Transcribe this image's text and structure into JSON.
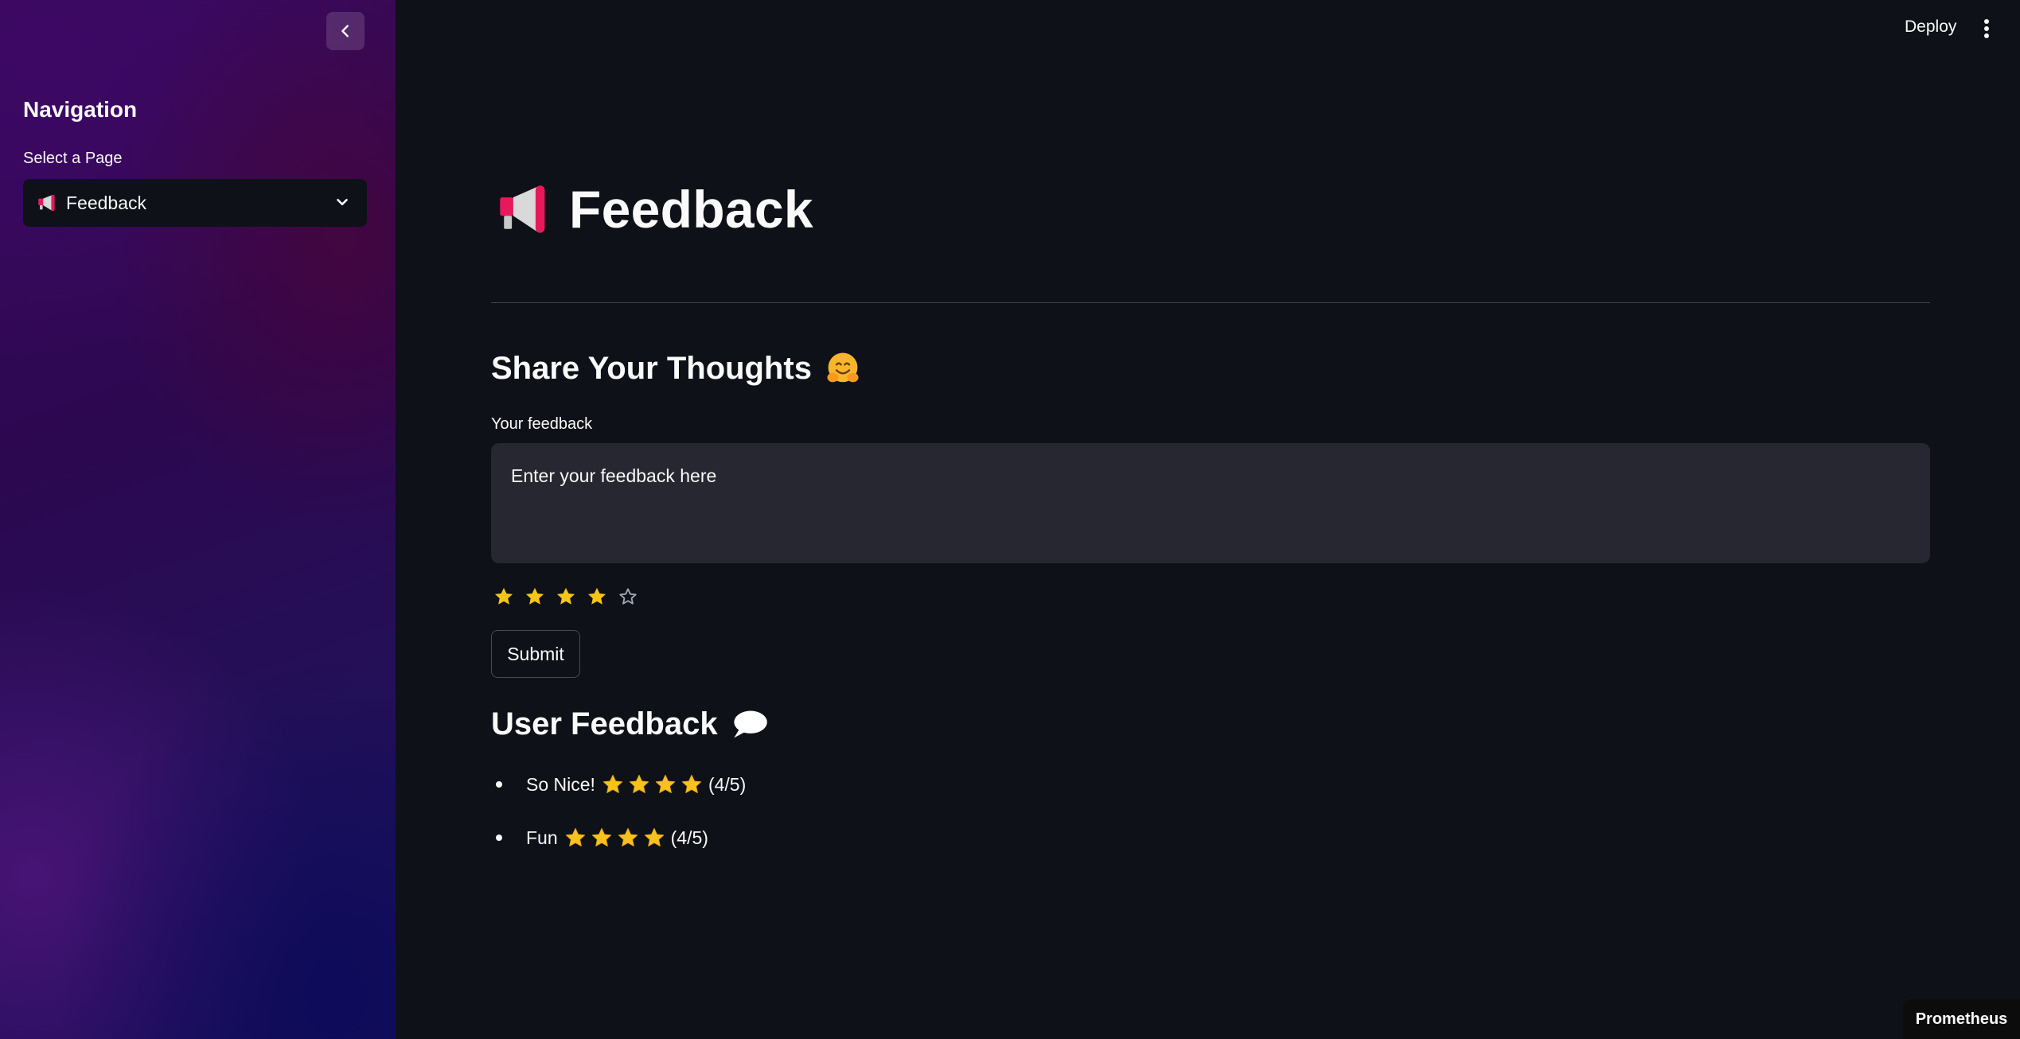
{
  "header": {
    "deploy_label": "Deploy"
  },
  "sidebar": {
    "title": "Navigation",
    "select_label": "Select a Page",
    "selected_page": "Feedback"
  },
  "main": {
    "title": "Feedback",
    "share_heading": "Share Your Thoughts",
    "feedback_label": "Your feedback",
    "feedback_placeholder": "Enter your feedback here",
    "feedback_value": "",
    "rating": 4,
    "rating_max": 5,
    "submit_label": "Submit",
    "user_feedback_heading": "User Feedback",
    "entries": [
      {
        "text": "So Nice!",
        "stars": 4,
        "score": "(4/5)"
      },
      {
        "text": "Fun",
        "stars": 4,
        "score": "(4/5)"
      }
    ]
  },
  "badge": "Prometheus",
  "colors": {
    "background": "#0e1117",
    "input_bg": "#262730",
    "star_filled": "#f5c518",
    "text": "#fafafa"
  },
  "icons": {
    "page_icon": "megaphone-icon",
    "share_emoji": "hugging-face-icon",
    "user_feedback_emoji": "speech-bubble-icon"
  }
}
